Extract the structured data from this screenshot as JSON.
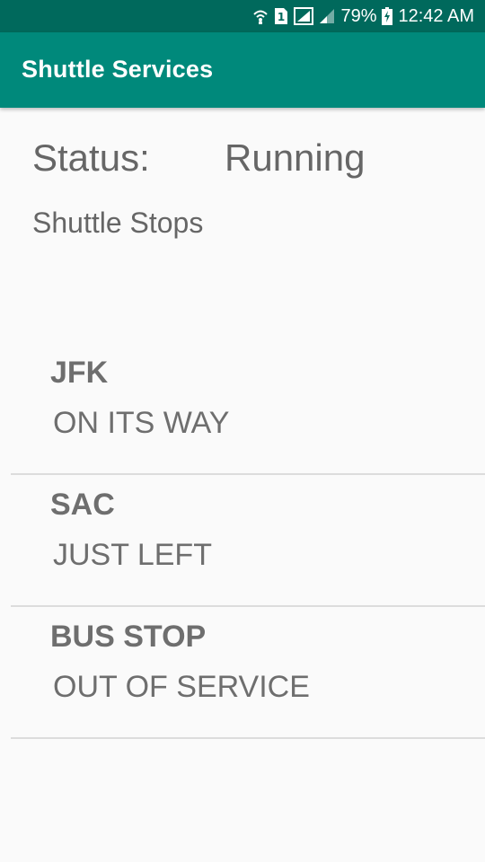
{
  "status_bar": {
    "icons": [
      "wifi-calling-icon",
      "sim-1-icon",
      "signal-icon",
      "signal-weak-icon",
      "battery-charging-icon"
    ],
    "sim_label": "1",
    "battery": "79%",
    "time": "12:42 AM"
  },
  "app_bar": {
    "title": "Shuttle Services"
  },
  "main": {
    "status_label": "Status:",
    "status_value": "Running",
    "section_title": "Shuttle Stops",
    "stops": [
      {
        "name": "JFK",
        "status": "ON ITS WAY"
      },
      {
        "name": "SAC",
        "status": "JUST LEFT"
      },
      {
        "name": "BUS STOP",
        "status": "OUT OF SERVICE"
      }
    ]
  },
  "colors": {
    "status_bar": "#00695c",
    "app_bar": "#00897b",
    "background": "#fafafa",
    "text": "#666666",
    "divider": "#dcdcdc"
  }
}
